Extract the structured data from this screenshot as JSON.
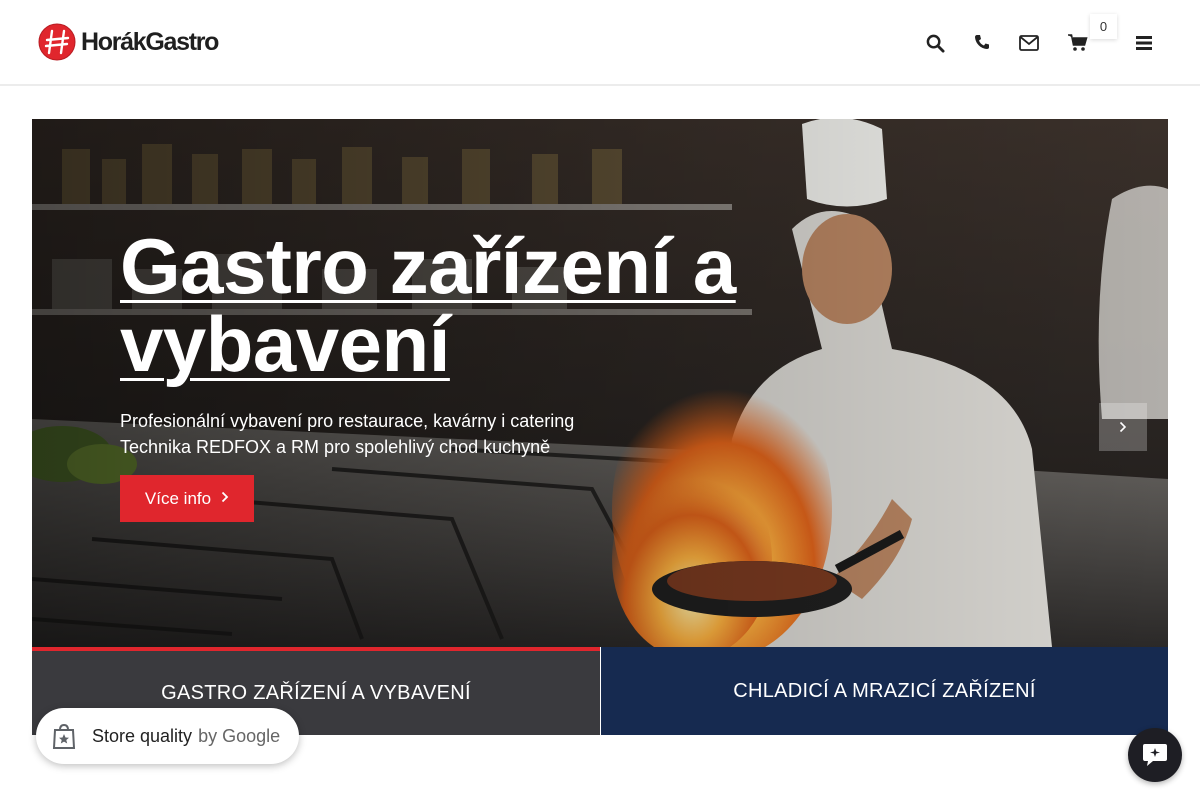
{
  "brand": {
    "name": "HorákGastro",
    "accent": "#e0262d"
  },
  "header": {
    "icons": [
      "search-icon",
      "phone-icon",
      "mail-icon",
      "cart-icon",
      "menu-icon"
    ],
    "cart_count": "0"
  },
  "hero": {
    "title": "Gastro zařízení a vybavení",
    "subtitle_line1": "Profesionální vybavení pro restaurace, kavárny i catering",
    "subtitle_line2": "Technika REDFOX a RM pro spolehlivý chod kuchyně",
    "button_label": "Více info",
    "next_icon": "chevron-right-icon"
  },
  "categories": [
    {
      "label": "GASTRO ZAŘÍZENÍ A VYBAVENÍ",
      "active": true,
      "color": "#3a3a3e"
    },
    {
      "label": "CHLADICÍ A MRAZICÍ ZAŘÍZENÍ",
      "active": false,
      "color": "#162a50"
    }
  ],
  "store_badge": {
    "label": "Store quality",
    "suffix": "by Google"
  },
  "chat": {
    "icon": "chat-icon"
  }
}
